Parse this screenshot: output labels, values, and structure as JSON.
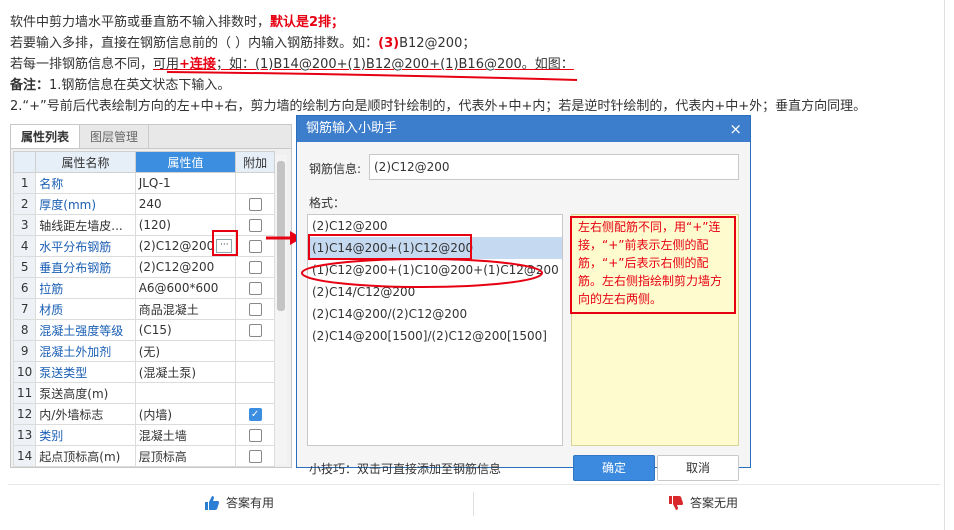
{
  "article": {
    "line1_text": "软件中剪力墙水平筋或垂直筋不输入排数时，",
    "line1_emph": "默认是2排；",
    "line2_pre": "若要输入多排，直接在钢筋信息前的（ ）内输入钢筋排数。如：",
    "line2_emph": "(3)",
    "line2_post": "B12@200；",
    "line3_pre": "若每一排钢筋信息不同，",
    "line3_mid": "可用",
    "line3_emph": "+连接",
    "line3_post": "；如：(1)B14@200+(1)B12@200+(1)B16@200。如图：",
    "line4_label": "备注：",
    "line4_text": "1.钢筋信息在英文状态下输入。",
    "line5_text": "2.“+”号前后代表绘制方向的左+中+右，剪力墙的绘制方向是顺时针绘制的，代表外+中+内；若是逆时针绘制的，代表内+中+外；垂直方向同理。"
  },
  "prop_panel": {
    "tabs": [
      "属性列表",
      "图层管理"
    ],
    "headers": [
      "属性名称",
      "属性值",
      "附加"
    ],
    "rows": [
      {
        "num": "1",
        "name": "名称",
        "value": "JLQ-1",
        "link": true,
        "check": null
      },
      {
        "num": "2",
        "name": "厚度(mm)",
        "value": "240",
        "link": true,
        "check": false
      },
      {
        "num": "3",
        "name": "轴线距左墙皮...",
        "value": "(120)",
        "link": false,
        "check": false
      },
      {
        "num": "4",
        "name": "水平分布钢筋",
        "value": "(2)C12@200",
        "link": true,
        "check": false
      },
      {
        "num": "5",
        "name": "垂直分布钢筋",
        "value": "(2)C12@200",
        "link": true,
        "check": false
      },
      {
        "num": "6",
        "name": "拉筋",
        "value": "A6@600*600",
        "link": true,
        "check": false
      },
      {
        "num": "7",
        "name": "材质",
        "value": "商品混凝土",
        "link": true,
        "check": false
      },
      {
        "num": "8",
        "name": "混凝土强度等级",
        "value": "(C15)",
        "link": true,
        "check": false
      },
      {
        "num": "9",
        "name": "混凝土外加剂",
        "value": "(无)",
        "link": true,
        "check": null
      },
      {
        "num": "10",
        "name": "泵送类型",
        "value": "(混凝土泵)",
        "link": true,
        "check": null
      },
      {
        "num": "11",
        "name": "泵送高度(m)",
        "value": "",
        "link": false,
        "check": null
      },
      {
        "num": "12",
        "name": "内/外墙标志",
        "value": "(内墙)",
        "link": false,
        "check": true
      },
      {
        "num": "13",
        "name": "类别",
        "value": "混凝土墙",
        "link": true,
        "check": false
      },
      {
        "num": "14",
        "name": "起点顶标高(m)",
        "value": "层顶标高",
        "link": false,
        "check": false
      }
    ]
  },
  "dialog": {
    "title": "钢筋输入小助手",
    "info_label": "钢筋信息:",
    "info_value": "(2)C12@200",
    "format_label": "格式：",
    "formats": [
      "(2)C12@200",
      "(1)C14@200+(1)C12@200",
      "(1)C12@200+(1)C10@200+(1)C12@200",
      "(2)C14/C12@200",
      "(2)C14@200/(2)C12@200",
      "(2)C14@200[1500]/(2)C12@200[1500]"
    ],
    "selected_index": 1,
    "note": "左右侧配筋不同，用“+”连接，“+”前表示左侧的配筋，“+”后表示右侧的配筋。左右侧指绘制剪力墙方向的左右两侧。",
    "tip": "小技巧：双击可直接添加至钢筋信息",
    "ok_label": "确定",
    "cancel_label": "取消"
  },
  "feedback": {
    "useful_label": "答案有用",
    "useless_label": "答案无用"
  },
  "colors": {
    "accent_blue": "#3c7dcc",
    "highlight_red": "#e60012",
    "note_bg": "#fefccf"
  }
}
